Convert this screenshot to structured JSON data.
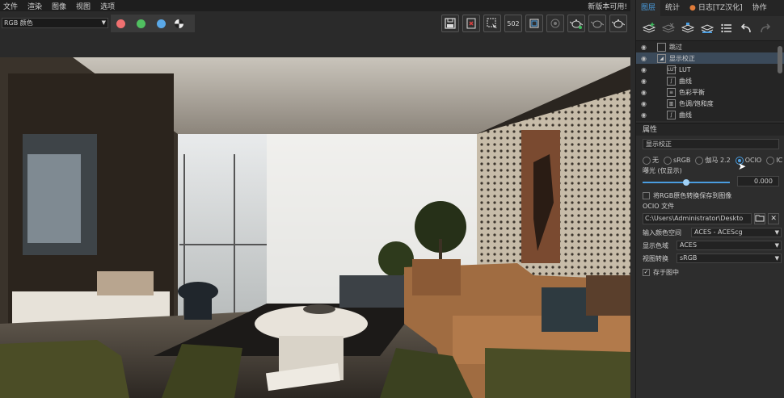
{
  "menu": {
    "items": [
      "文件",
      "渲染",
      "图像",
      "视图",
      "选项"
    ],
    "update_notice": "新版本可用!"
  },
  "toolbar": {
    "color_space": "RGB 颜色",
    "channel_colors": [
      "#f07070",
      "#50c060",
      "#5aa8e8"
    ],
    "tool_icons": [
      "save-icon",
      "close-file-icon",
      "region-render-icon",
      "stereo-icon",
      "frame-icon",
      "lens-icon",
      "teapot-render-icon",
      "teapot-icon",
      "teapot-settings-icon"
    ],
    "stereo_label": "502"
  },
  "panel": {
    "tabs": [
      {
        "label": "图层",
        "active": true
      },
      {
        "label": "统计",
        "active": false
      },
      {
        "label": "日志[TZ汉化]",
        "active": false,
        "marker": "●"
      },
      {
        "label": "协作",
        "active": false
      }
    ],
    "layers": [
      {
        "label": "跳过",
        "icon": "",
        "selected": false,
        "sub": false
      },
      {
        "label": "显示校正",
        "icon": "◢",
        "selected": true,
        "sub": false
      },
      {
        "label": "LUT",
        "icon": "LUT",
        "selected": false,
        "sub": true
      },
      {
        "label": "曲线",
        "icon": "∫",
        "selected": false,
        "sub": true
      },
      {
        "label": "色彩平衡",
        "icon": "≡",
        "selected": false,
        "sub": true
      },
      {
        "label": "色调/饱和度",
        "icon": "▥",
        "selected": false,
        "sub": true
      },
      {
        "label": "曲线",
        "icon": "∫",
        "selected": false,
        "sub": true
      }
    ],
    "properties": {
      "header": "属性",
      "name": "显示校正",
      "radios": [
        {
          "label": "无",
          "on": false
        },
        {
          "label": "sRGB",
          "on": false
        },
        {
          "label": "伽马 2.2",
          "on": false
        },
        {
          "label": "OCIO",
          "on": true
        },
        {
          "label": "IC",
          "on": false
        }
      ],
      "exposure_label": "曝光 (仅显示)",
      "exposure_value": "0.000",
      "exposure_fraction": 0.5,
      "save_check": "将RGB原色转换保存到图像",
      "ocio_label": "OCIO 文件",
      "ocio_path": "C:\\Users\\Administrator\\Deskto",
      "input_label": "输入颜色空间",
      "input_value": "ACES - ACEScg",
      "display_label": "显示色域",
      "display_value": "ACES",
      "view_label": "视图转换",
      "view_value": "sRGB",
      "inview_check": "存于图中"
    }
  }
}
